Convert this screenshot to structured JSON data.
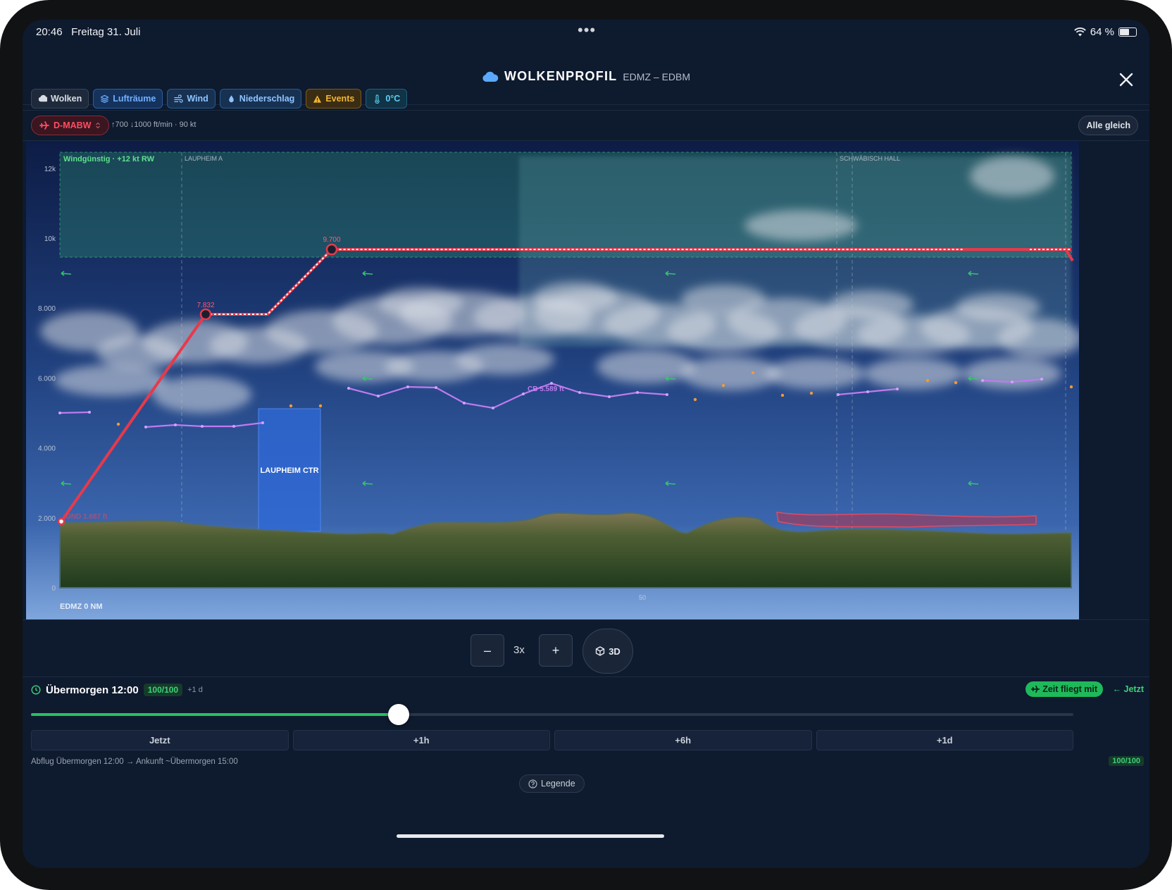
{
  "status_bar": {
    "time": "20:46",
    "date": "Freitag 31. Juli",
    "battery": "64 %",
    "battery_level": 0.64
  },
  "header": {
    "title": "WOLKENPROFIL",
    "route": "EDMZ – EDBM"
  },
  "layers": [
    {
      "label": "Wolken",
      "icon": "cloud-icon",
      "style": "grey"
    },
    {
      "label": "Lufträume",
      "icon": "layers-icon",
      "style": "blue"
    },
    {
      "label": "Wind",
      "icon": "wind-icon",
      "style": "bluel"
    },
    {
      "label": "Niederschlag",
      "icon": "droplet-icon",
      "style": "bluel"
    },
    {
      "label": "Events",
      "icon": "warning-icon",
      "style": "orange"
    },
    {
      "label": "0°C",
      "icon": "thermometer-icon",
      "style": "teal"
    }
  ],
  "aircraft": {
    "registration": "D-MABW",
    "performance": "↑700 ↓1000 ft/min · 90 kt"
  },
  "align_button": "Alle gleich",
  "profile": {
    "wind_banner": "Windgünstig · +12 kt RW",
    "y_axis_labels": [
      "12k",
      "10k",
      "8.000",
      "6.000",
      "4.000",
      "2.000",
      "0"
    ],
    "airspace_labels": [
      "LAUPHEIM A",
      "SCHWÄBISCH HALL"
    ],
    "ctr_label": "LAUPHEIM CTR",
    "waypoint_labels": [
      "7.832",
      "9.700"
    ],
    "gnd_label": "GND 1.687 ft",
    "cloud_base_label": "CB 5.589 ft",
    "x_start_label": "EDMZ 0 NM",
    "x_mid_label": "50"
  },
  "zoom": {
    "minus": "–",
    "value": "3x",
    "plus": "+",
    "view_3d": "3D"
  },
  "time_panel": {
    "label": "Übermorgen 12:00",
    "score": "100/100",
    "offset": "+1 d",
    "follow_button": "Zeit fliegt mit",
    "now_link": "← Jetzt",
    "slider_fraction": 0.353,
    "steps": [
      "Jetzt",
      "+1h",
      "+6h",
      "+1d"
    ],
    "flight_info": "Abflug Übermorgen 12:00 → Ankunft ~Übermorgen 15:00",
    "score_right": "100/100",
    "legend_button": "Legende"
  },
  "colors": {
    "accent_green": "#25c25f",
    "route_red": "#e8394b",
    "cloud_base": "#c07af0",
    "ctr_blue": "#2f6ad9"
  }
}
